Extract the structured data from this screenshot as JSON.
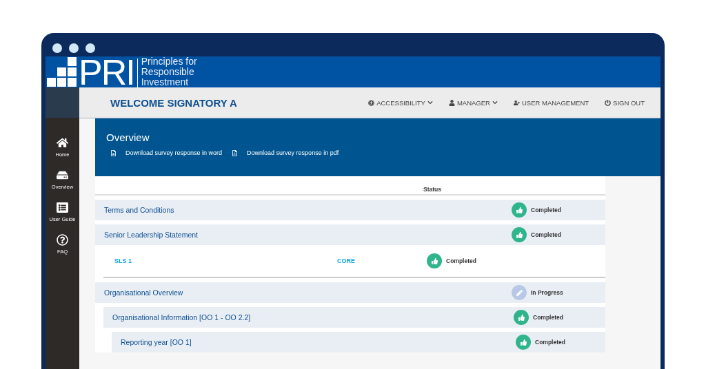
{
  "brand": {
    "mark": "PRI",
    "name_lines": [
      "Principles for",
      "Responsible",
      "Investment"
    ]
  },
  "welcome": "WELCOME SIGNATORY A",
  "top_menu": [
    {
      "label": "ACCESSIBILITY",
      "kind": "accessibility",
      "dropdown": true
    },
    {
      "label": "MANAGER",
      "kind": "user",
      "dropdown": true
    },
    {
      "label": "USER MANAGEMENT",
      "kind": "user-add",
      "dropdown": false
    },
    {
      "label": "SIGN OUT",
      "kind": "power",
      "dropdown": false
    }
  ],
  "sidebar": {
    "items": [
      {
        "label": "Home",
        "kind": "home"
      },
      {
        "label": "Overview",
        "kind": "drive"
      },
      {
        "label": "User Guide",
        "kind": "guide"
      },
      {
        "label": "FAQ",
        "kind": "faq"
      }
    ]
  },
  "overview": {
    "title": "Overview",
    "downloads": [
      {
        "label": "Download survey response in word",
        "kind": "word"
      },
      {
        "label": "Download survey response in pdf",
        "kind": "pdf"
      }
    ]
  },
  "table": {
    "status_heading": "Status",
    "rows": [
      {
        "kind": "section",
        "title": "Terms and Conditions",
        "status": "Completed",
        "completed": true
      },
      {
        "kind": "section",
        "title": "Senior Leadership Statement",
        "status": "Completed",
        "completed": true,
        "children": [
          {
            "kind": "indicator",
            "title": "SLS 1",
            "tag": "CORE",
            "status": "Completed",
            "completed": true
          }
        ]
      },
      {
        "kind": "section",
        "title": "Organisational Overview",
        "status": "In Progress",
        "completed": false,
        "children": [
          {
            "kind": "section",
            "title": "Organisational Information [OO 1 - OO 2.2]",
            "status": "Completed",
            "completed": true,
            "children": [
              {
                "kind": "section",
                "title": "Reporting year [OO 1]",
                "status": "Completed",
                "completed": true
              }
            ]
          }
        ]
      }
    ]
  }
}
